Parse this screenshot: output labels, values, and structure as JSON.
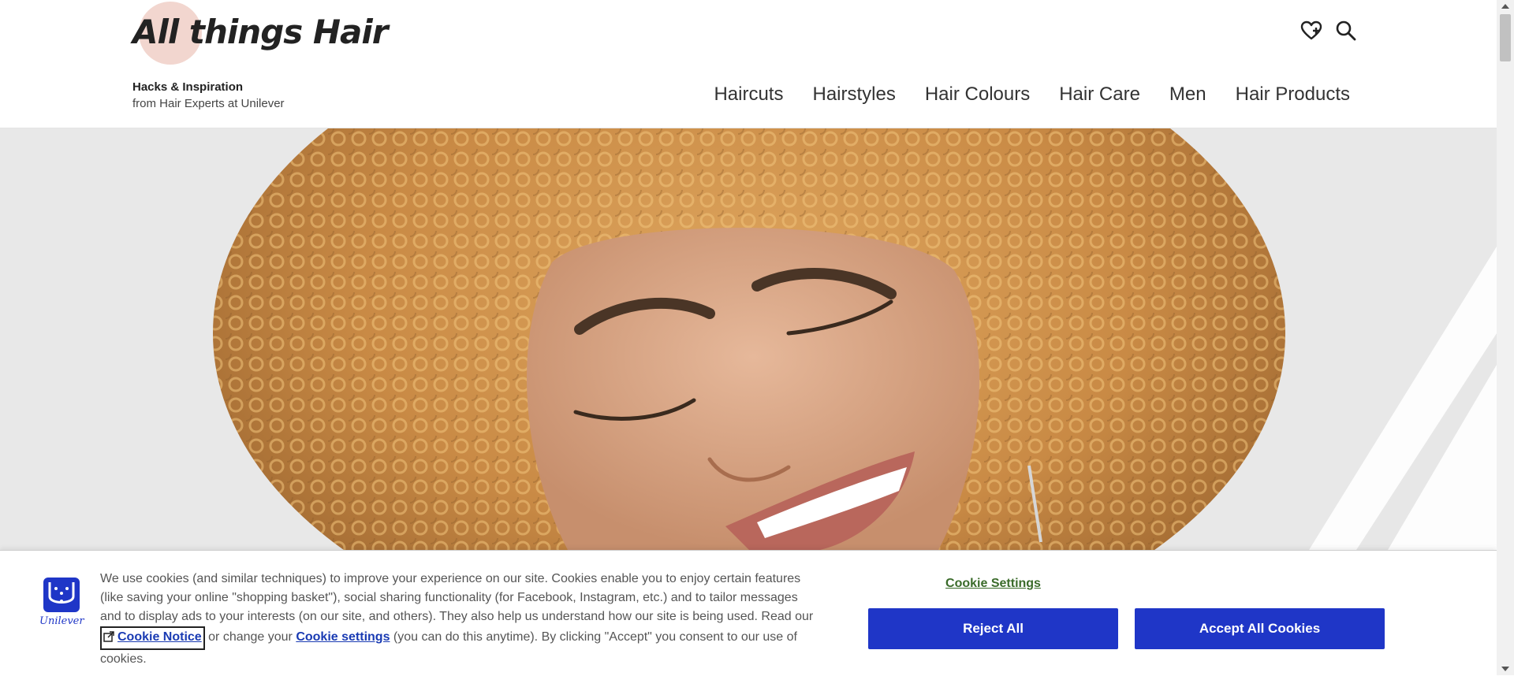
{
  "site": {
    "logo_text": "All things Hair",
    "tagline_title": "Hacks & Inspiration",
    "tagline_sub": "from Hair Experts at Unilever"
  },
  "header_icons": [
    "heart-plus-icon",
    "search-icon"
  ],
  "nav": {
    "items": [
      {
        "label": "Haircuts"
      },
      {
        "label": "Hairstyles"
      },
      {
        "label": "Hair Colours"
      },
      {
        "label": "Hair Care"
      },
      {
        "label": "Men"
      },
      {
        "label": "Hair Products"
      }
    ]
  },
  "cookie_banner": {
    "brand": "Unilever",
    "text_1": "We use cookies (and similar techniques) to improve your experience on our site. Cookies enable you to enjoy certain features (like saving your online \"shopping basket\"), social sharing functionality (for Facebook, Instagram, etc.) and to tailor messages and to display ads to your interests (on our site, and others). They also help us understand how our site is being used. Read our",
    "notice_link": "Cookie Notice",
    "text_2": "or change your",
    "settings_link": "Cookie settings",
    "text_3": "(you can do this anytime). By clicking \"Accept\" you consent to our use of cookies.",
    "settings_button": "Cookie Settings",
    "reject_button": "Reject All",
    "accept_button": "Accept All Cookies"
  },
  "colors": {
    "button_blue": "#1f36c7",
    "settings_green": "#3a6b2a",
    "logo_circle": "#f2d6cf"
  }
}
